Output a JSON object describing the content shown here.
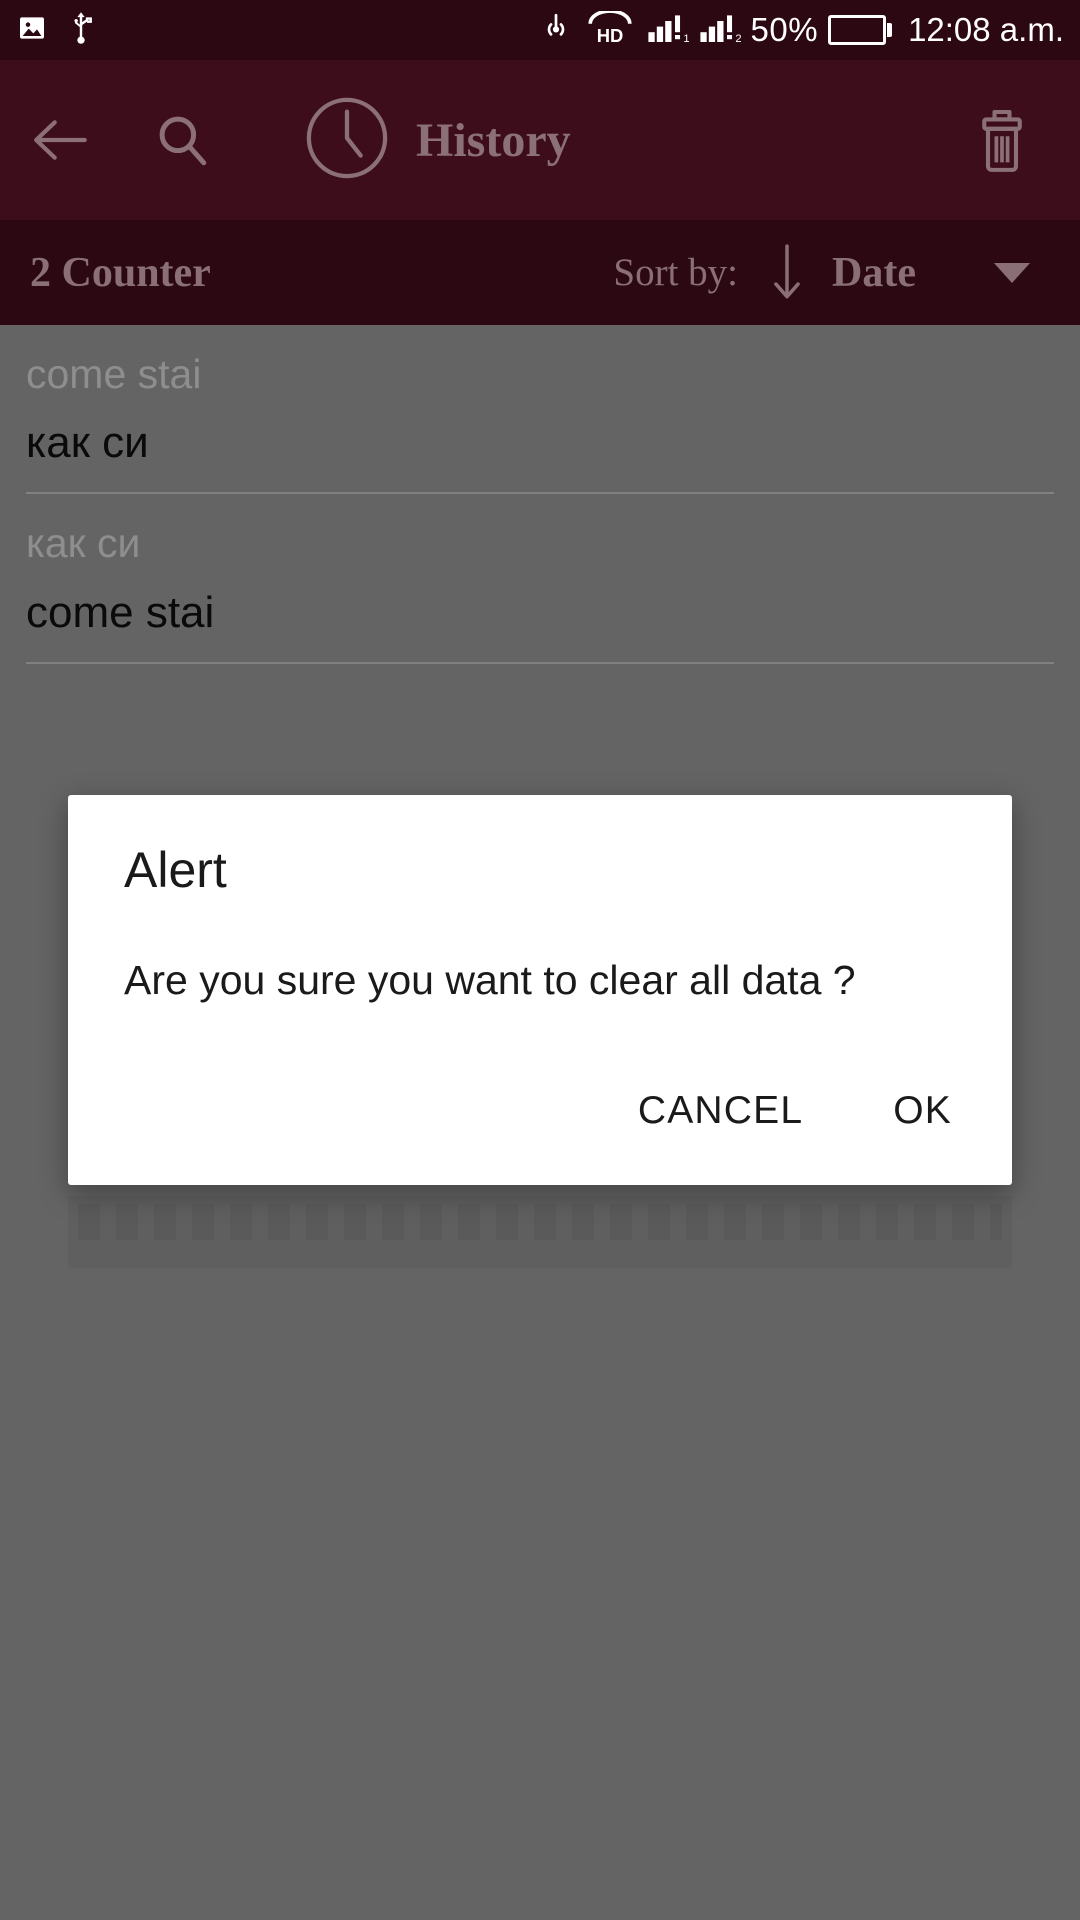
{
  "status_bar": {
    "left_icons": [
      "image-icon",
      "usb-icon"
    ],
    "right_icons": [
      "cast-icon",
      "hd-voice-icon",
      "signal-sim1-icon",
      "signal-sim2-icon"
    ],
    "battery_percent_label": "50%",
    "battery_level": 50,
    "time": "12:08 a.m.",
    "background_color": "#2c0813",
    "battery_color": "#16dd16"
  },
  "app_bar": {
    "back_icon": "arrow-left-icon",
    "search_icon": "search-icon",
    "clock_icon": "clock-icon",
    "title": "History",
    "delete_icon": "trash-icon",
    "background_color": "#3d0d1c",
    "foreground_color": "#8c7077"
  },
  "sort_bar": {
    "counter_label": "2 Counter",
    "sort_by_label": "Sort by:",
    "direction_icon": "arrow-down-icon",
    "sort_value": "Date",
    "dropdown_icon": "caret-down-icon",
    "background_color": "#2c0813"
  },
  "history": {
    "items": [
      {
        "source_text": "come stai",
        "target_text": "как си"
      },
      {
        "source_text": "как си",
        "target_text": "come stai"
      }
    ]
  },
  "dialog": {
    "title": "Alert",
    "message": "Are you sure you want to clear all data ?",
    "cancel_label": "CANCEL",
    "ok_label": "OK",
    "background_color": "#ffffff"
  }
}
